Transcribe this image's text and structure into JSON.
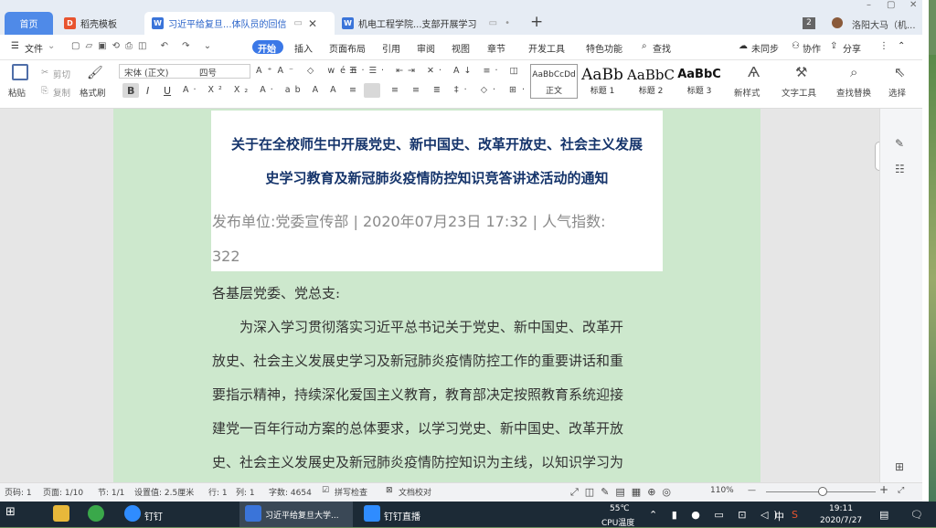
{
  "tabs": {
    "home": "首页",
    "daoke": "稻壳模板",
    "doc1": "习近平给复旦...体队员的回信",
    "doc2": "机电工程学院...支部开展学习",
    "count": "2",
    "user": "洛阳大马（机..."
  },
  "menu": {
    "file": "文件",
    "items": [
      "开始",
      "插入",
      "页面布局",
      "引用",
      "审阅",
      "视图",
      "章节",
      "开发工具",
      "特色功能"
    ],
    "search": "查找",
    "sync": "未同步",
    "collab": "协作",
    "share": "分享"
  },
  "toolbar": {
    "paste": "粘贴",
    "cut": "剪切",
    "copy": "复制",
    "format_painter": "格式刷",
    "font": "宋体 (正文)",
    "size": "四号",
    "bold": "B",
    "italic": "I",
    "underline": "U",
    "styles": [
      {
        "preview": "AaBbCcDd",
        "name": "正文"
      },
      {
        "preview": "AaBb",
        "name": "标题 1"
      },
      {
        "preview": "AaBbC",
        "name": "标题 2"
      },
      {
        "preview": "AaBbC",
        "name": "标题 3"
      }
    ],
    "new_style": "新样式",
    "text_tools": "文字工具",
    "find_replace": "查找替换",
    "select": "选择"
  },
  "doc": {
    "title_line1": "关于在全校师生中开展党史、新中国史、改革开放史、社会主义发展",
    "title_line2": "史学习教育及新冠肺炎疫情防控知识竞答讲述活动的通知",
    "meta_line1": "发布单位:党委宣传部  |  2020年07月23日 17:32  |  人气指数:",
    "meta_line2": "322",
    "greeting": "各基层党委、党总支:",
    "para": [
      "　　为深入学习贯彻落实习近平总书记关于党史、新中国史、改革开",
      "放史、社会主义发展史学习及新冠肺炎疫情防控工作的重要讲话和重",
      "要指示精神，持续深化爱国主义教育，教育部决定按照教育系统迎接",
      "建党一百年行动方案的总体要求，以学习党史、新中国史、改革开放",
      "史、社会主义发展史及新冠肺炎疫情防控知识为主线，以知识学习为"
    ]
  },
  "status": {
    "page_no": "页码: 1",
    "pages": "页面: 1/10",
    "section": "节: 1/1",
    "setting": "设置值: 2.5厘米",
    "row": "行: 1",
    "col": "列: 1",
    "words": "字数: 4654",
    "spell": "拼写检查",
    "proof": "文档校对",
    "zoom": "110%"
  },
  "taskbar": {
    "dingding": "钉钉",
    "word_app": "习近平给复旦大学...",
    "dd_live": "钉钉直播",
    "temp": "55℃",
    "temp_label": "CPU温度",
    "ime": "中",
    "time": "19:11",
    "date": "2020/7/27"
  }
}
